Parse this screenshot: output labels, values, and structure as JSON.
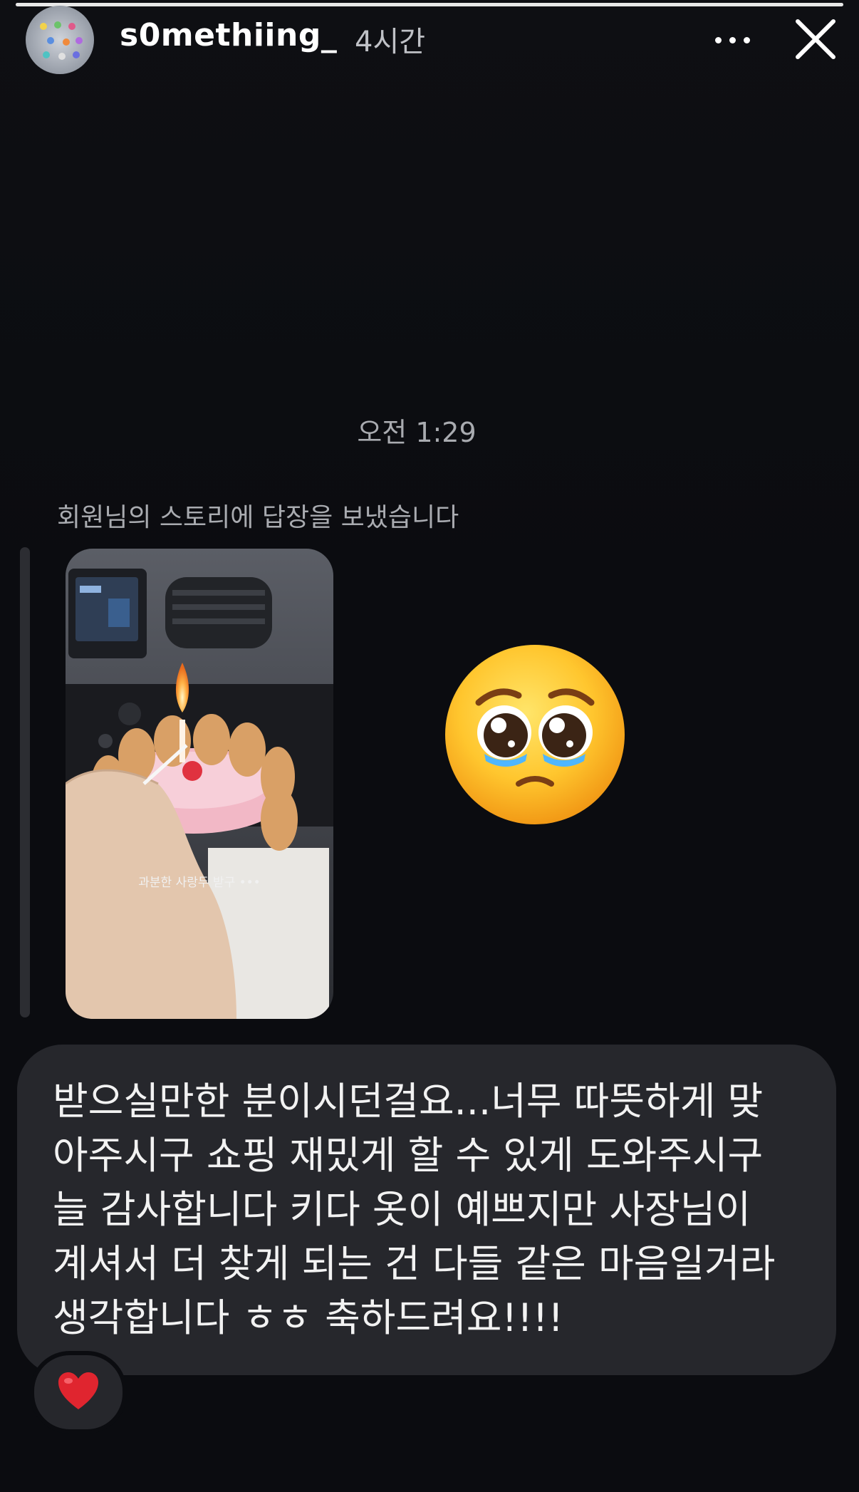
{
  "story_progress": 1.0,
  "header": {
    "username": "s0methiing_",
    "time_ago": "4시간",
    "more_icon": "more-horizontal-icon",
    "close_icon": "close-icon"
  },
  "thread": {
    "timestamp": "오전 1:29",
    "reply_note": "회원님의 스토리에 답장을 보냈습니다",
    "story_caption": "과분한 사랑두 받구 •••",
    "reaction_emoji": "🥹",
    "message_text": "받으실만한 분이시던걸요...너무 따뜻하게 맞\n아주시구 쇼핑 재밌게 할 수 있게 도와주시구\n늘 감사합니다 키다 옷이 예쁘지만 사장님이\n계셔서 더 찾게 되는 건 다들 같은 마음일거라\n생각합니다 ㅎㅎ 축하드려요!!!!",
    "message_reaction": "❤️"
  },
  "colors": {
    "background": "#0b0c10",
    "bubble": "#26272c",
    "muted_text": "#a9abb0",
    "heart": "#e0252f"
  }
}
